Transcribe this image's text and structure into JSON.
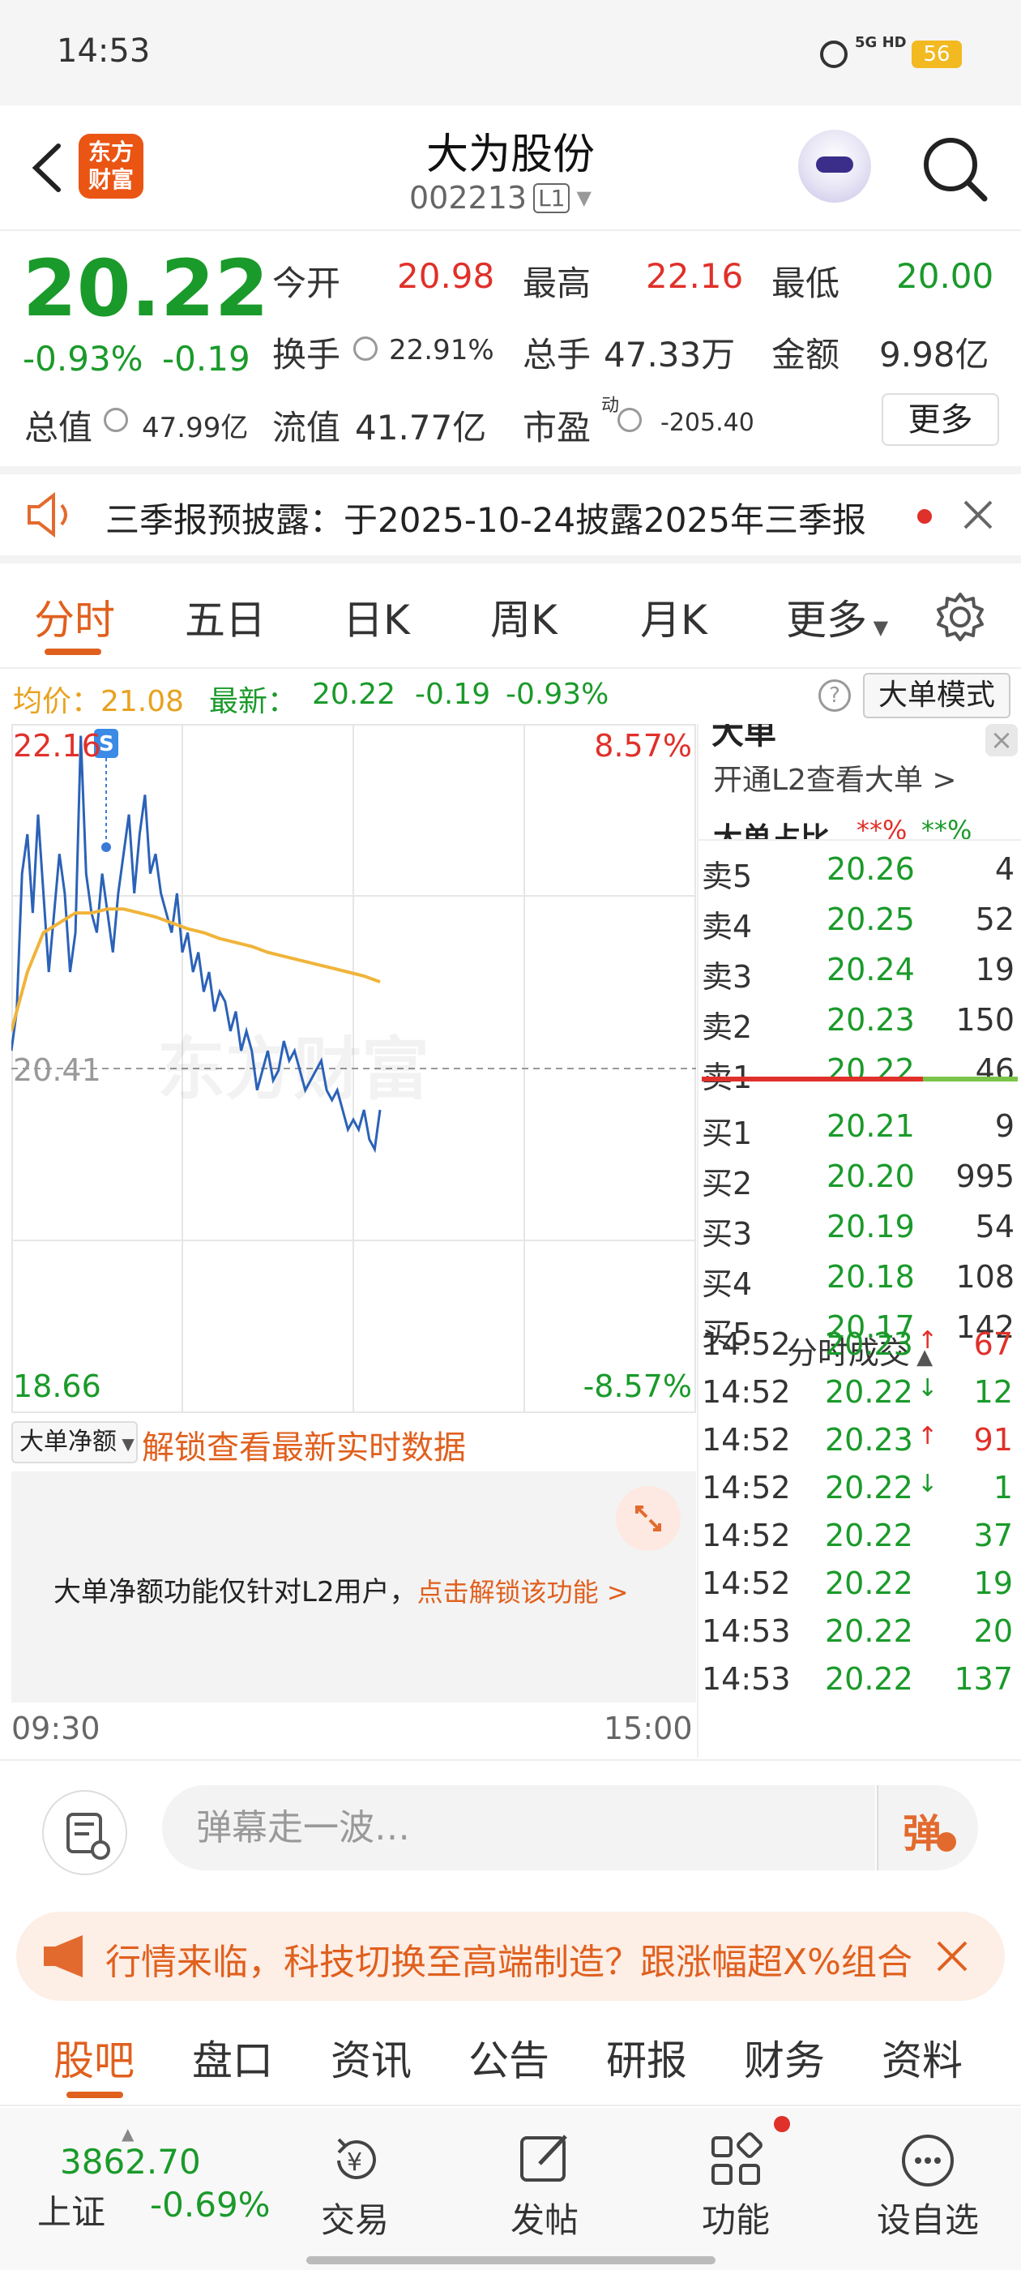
{
  "status_bar": {
    "time": "14:53",
    "network": "5G HD",
    "battery": "56"
  },
  "header": {
    "brand_logo": "东方\n财富",
    "title": "大为股份",
    "code": "002213",
    "level": "L1"
  },
  "quote": {
    "price": "20.22",
    "change_pct": "-0.93%",
    "change": "-0.19",
    "open_label": "今开",
    "open": "20.98",
    "high_label": "最高",
    "high": "22.16",
    "low_label": "最低",
    "low": "20.00",
    "turnover_label": "换手",
    "turnover": "22.91%",
    "volume_label": "总手",
    "volume": "47.33万",
    "amount_label": "金额",
    "amount": "9.98亿",
    "mcap_label": "总值",
    "mcap": "47.99亿",
    "float_label": "流值",
    "float": "41.77亿",
    "pe_label": "市盈",
    "pe_sup": "动",
    "pe": "-205.40",
    "more_btn": "更多"
  },
  "notice": {
    "text": "三季报预披露：于2025-10-24披露2025年三季报"
  },
  "chart_tabs": [
    "分时",
    "五日",
    "日K",
    "周K",
    "月K",
    "更多"
  ],
  "legend": {
    "avg_label": "均价：21.08",
    "latest_label": "最新：",
    "latest": "20.22",
    "chg": "-0.19",
    "pct": "-0.93%",
    "mode_btn": "大单模式"
  },
  "chart_data": {
    "type": "line",
    "title": "",
    "y_max_label": "22.16",
    "y_mid_label": "20.41",
    "y_min_label": "18.66",
    "pct_max": "8.57%",
    "pct_min": "-8.57%",
    "x_start": "09:30",
    "x_end": "15:00",
    "marker": "S",
    "watermark": "东方财富",
    "ylim": [
      18.66,
      22.16
    ],
    "series": [
      {
        "name": "",
        "color": "#2b62b8",
        "values": [
          20.5,
          20.7,
          21.4,
          21.6,
          21.2,
          21.7,
          21.3,
          20.9,
          21.2,
          21.5,
          21.3,
          20.9,
          21.1,
          22.1,
          21.4,
          21.2,
          21.1,
          21.4,
          21.2,
          21.0,
          21.3,
          21.5,
          21.7,
          21.3,
          21.6,
          21.8,
          21.4,
          21.5,
          21.3,
          21.2,
          21.1,
          21.3,
          21.0,
          21.1,
          20.9,
          21.0,
          20.8,
          20.9,
          20.7,
          20.8,
          20.75,
          20.6,
          20.7,
          20.5,
          20.6,
          20.5,
          20.3,
          20.4,
          20.5,
          20.35,
          20.4,
          20.55,
          20.45,
          20.5,
          20.4,
          20.3,
          20.35,
          20.4,
          20.45,
          20.3,
          20.25,
          20.3,
          20.2,
          20.1,
          20.15,
          20.1,
          20.2,
          20.05,
          20.0,
          20.2
        ]
      },
      {
        "name": "",
        "color": "#f0b43a",
        "values": [
          20.6,
          20.9,
          21.1,
          21.15,
          21.2,
          21.2,
          21.22,
          21.22,
          21.2,
          21.18,
          21.15,
          21.12,
          21.1,
          21.07,
          21.05,
          21.03,
          21.0,
          20.98,
          20.96,
          20.94,
          20.92,
          20.9,
          20.88,
          20.85
        ]
      }
    ]
  },
  "orderbook": {
    "top_panel": {
      "title": "大单",
      "l2_link": "开通L2查看大单 >",
      "ratio_label": "大单占比",
      "ratio_red": "**%",
      "ratio_green": "**%"
    },
    "asks": [
      {
        "label": "卖5",
        "price": "20.26",
        "vol": "4"
      },
      {
        "label": "卖4",
        "price": "20.25",
        "vol": "52"
      },
      {
        "label": "卖3",
        "price": "20.24",
        "vol": "19"
      },
      {
        "label": "卖2",
        "price": "20.23",
        "vol": "150"
      },
      {
        "label": "卖1",
        "price": "20.22",
        "vol": "46"
      }
    ],
    "bids": [
      {
        "label": "买1",
        "price": "20.21",
        "vol": "9"
      },
      {
        "label": "买2",
        "price": "20.20",
        "vol": "995"
      },
      {
        "label": "买3",
        "price": "20.19",
        "vol": "54"
      },
      {
        "label": "买4",
        "price": "20.18",
        "vol": "108"
      },
      {
        "label": "买5",
        "price": "20.17",
        "vol": "142"
      }
    ]
  },
  "ticks": {
    "title": "分时成交",
    "rows": [
      {
        "t": "14:52",
        "p": "20.23",
        "d": "up",
        "v": "67"
      },
      {
        "t": "14:52",
        "p": "20.22",
        "d": "down",
        "v": "12"
      },
      {
        "t": "14:52",
        "p": "20.23",
        "d": "up",
        "v": "91"
      },
      {
        "t": "14:52",
        "p": "20.22",
        "d": "down",
        "v": "1"
      },
      {
        "t": "14:52",
        "p": "20.22",
        "d": "",
        "v": "37"
      },
      {
        "t": "14:52",
        "p": "20.22",
        "d": "",
        "v": "19"
      },
      {
        "t": "14:53",
        "p": "20.22",
        "d": "",
        "v": "20"
      },
      {
        "t": "14:53",
        "p": "20.22",
        "d": "",
        "v": "137"
      }
    ]
  },
  "big_order": {
    "dropdown": "大单净额",
    "unlock_link": "解锁查看最新实时数据",
    "panel_text": "大单净额功能仅针对L2用户，",
    "panel_link": "点击解锁该功能 >"
  },
  "chat": {
    "placeholder": "弹幕走一波…",
    "send": "弹"
  },
  "promo": {
    "text": "行情来临，科技切换至高端制造？跟涨幅超X%组合"
  },
  "bottom_tabs": [
    "股吧",
    "盘口",
    "资讯",
    "公告",
    "研报",
    "财务",
    "资料"
  ],
  "nav": {
    "index_value": "3862.70",
    "index_name": "上证",
    "index_pct": "-0.69%",
    "trade": "交易",
    "post": "发帖",
    "feature": "功能",
    "watch": "设自选"
  }
}
